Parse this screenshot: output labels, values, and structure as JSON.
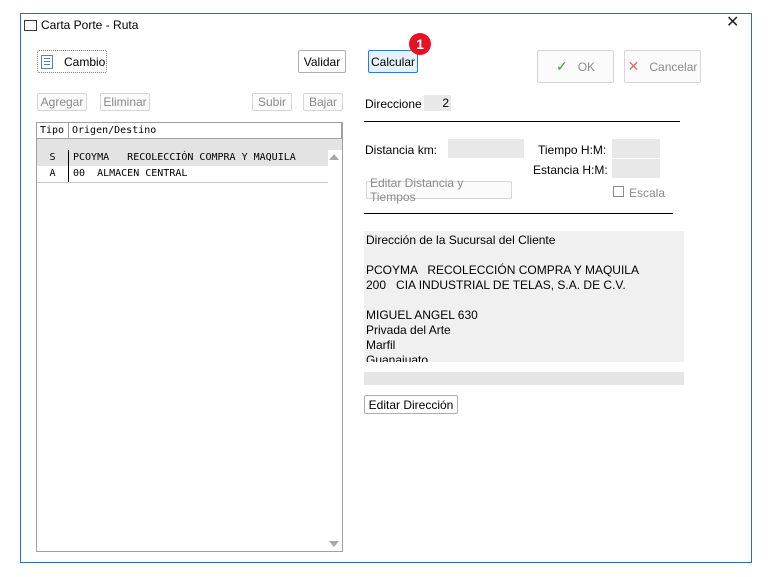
{
  "window": {
    "title": "Carta Porte - Ruta",
    "close_glyph": "✕"
  },
  "toolbar": {
    "cambio_label": "Cambio",
    "validar_label": "Validar",
    "calcular_label": "Calcular",
    "badge_count": "1",
    "ok_label": "OK",
    "cancelar_label": "Cancelar"
  },
  "list_toolbar": {
    "agregar_label": "Agregar",
    "eliminar_label": "Eliminar",
    "subir_label": "Subir",
    "bajar_label": "Bajar"
  },
  "grid": {
    "columns": [
      "Tipo",
      "Origen/Destino"
    ],
    "rows": [
      {
        "tipo": "S",
        "origen": "PCOYMA   RECOLECCIÓN COMPRA Y MAQUILA"
      },
      {
        "tipo": "A",
        "origen": "00  ALMACEN CENTRAL"
      }
    ]
  },
  "details": {
    "direccione_label": "Direccione",
    "direccione_value": "2",
    "distancia_label": "Distancia km:",
    "distancia_value": "",
    "tiempo_label": "Tiempo H:M:",
    "tiempo_value": "",
    "estancia_label": "Estancia H:M:",
    "estancia_value": "",
    "editar_dist_label": "Editar Distancia y Tiempos",
    "escala_label": "Escala",
    "escala_checked": false
  },
  "address": {
    "lines": [
      "Dirección de la Sucursal del Cliente",
      "",
      "PCOYMA   RECOLECCIÓN COMPRA Y MAQUILA",
      "200   CIA INDUSTRIAL DE TELAS, S.A. DE C.V.",
      "",
      "MIGUEL ANGEL 630",
      "Privada del Arte",
      "Marfil",
      "Guanajuato"
    ],
    "editar_label": "Editar Dirección"
  },
  "colors": {
    "accent": "#2c7ad6",
    "badge": "#e81123",
    "window_border": "#2b6fb6",
    "ok_check": "#3a9d3a",
    "cancel_x": "#e06a6a"
  }
}
